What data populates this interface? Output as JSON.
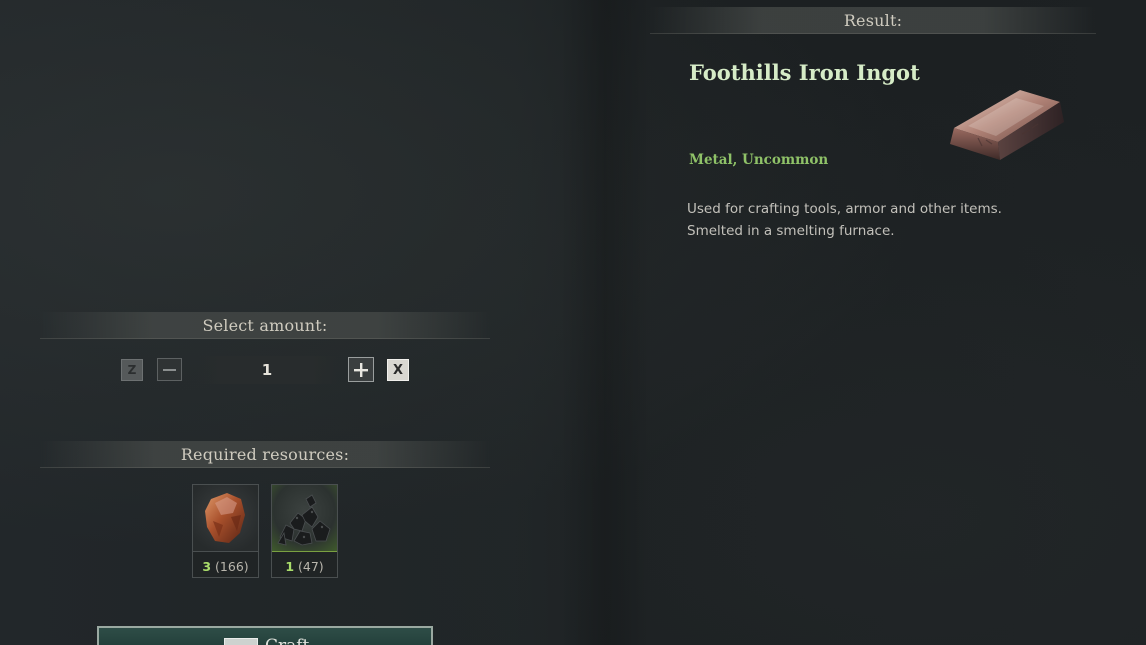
{
  "amount_section": {
    "header": "Select amount:",
    "reset_key": "Z",
    "amount_value": "1",
    "clear_key": "X"
  },
  "resources_section": {
    "header": "Required resources:",
    "items": [
      {
        "icon": "iron-ore-icon",
        "required": "3",
        "owned": "(166)"
      },
      {
        "icon": "coal-icon",
        "required": "1",
        "owned": "(47)"
      }
    ]
  },
  "craft_button": {
    "label": "Craft"
  },
  "result": {
    "header": "Result:",
    "item_name": "Foothills Iron Ingot",
    "category": "Metal, Uncommon",
    "description_lines": [
      "Used for crafting tools, armor and other items.",
      "Smelted in a smelting furnace."
    ],
    "icon": "iron-ingot-icon"
  },
  "colors": {
    "title_green": "#d6ecc7",
    "category_green": "#8fc268",
    "count_green": "#a9dc6a"
  }
}
